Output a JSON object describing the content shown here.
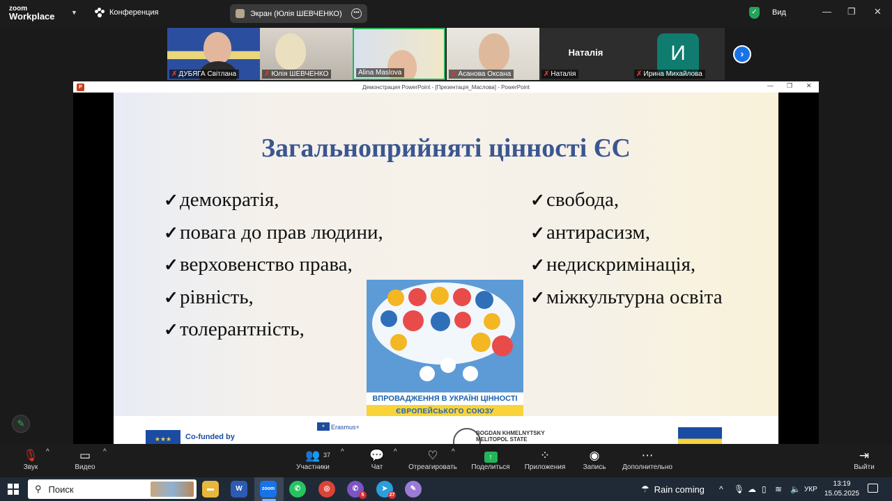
{
  "zoom": {
    "logo_line1": "zoom",
    "logo_line2": "Workplace",
    "conference_label": "Конференция",
    "screen_share_label": "Экран (Юлія ШЕВЧЕНКО)",
    "view_label": "Вид"
  },
  "participants": [
    {
      "name": "ДУБЯГА Світлана",
      "muted": true
    },
    {
      "name": "Юлія ШЕВЧЕНКО",
      "muted": true
    },
    {
      "name": "Alina Maslova",
      "muted": false,
      "active_speaker": true
    },
    {
      "name": "Асанова Оксана",
      "muted": true
    },
    {
      "name": "Наталія",
      "muted": true,
      "display_name": "Наталія"
    },
    {
      "name": "Ирина Михайлова",
      "muted": true,
      "initial": "И"
    }
  ],
  "powerpoint": {
    "window_title": "Демонстрация PowerPoint - [Презентація_Маслова] - PowerPoint"
  },
  "slide": {
    "title": "Загальноприйняті цінності ЄС",
    "left_items": [
      "демократія,",
      "повага до прав людини,",
      "верховенство права,",
      "рівність,",
      "толерантність,"
    ],
    "right_items": [
      "свобода,",
      "антирасизм,",
      "недискримінація,",
      "міжкультурна освіта"
    ],
    "poster_line1": "ВПРОВАДЖЕННЯ В УКРАЇНІ ЦІННОСТІ",
    "poster_line2": "ЄВРОПЕЙСЬКОГО СОЮЗУ",
    "footer_cofunded": "Co-funded by",
    "footer_erasmus": "Erasmus+",
    "footer_univ_line1": "BOGDAN KHMELNYTSKY",
    "footer_univ_line2": "MELITOPOL STATE"
  },
  "toolbar": {
    "sound": "Звук",
    "video": "Видео",
    "participants": "Участники",
    "participants_count": "37",
    "chat": "Чат",
    "react": "Отреагировать",
    "share": "Поделиться",
    "apps": "Приложения",
    "record": "Запись",
    "more": "Дополнительно",
    "leave": "Выйти"
  },
  "taskbar": {
    "search_placeholder": "Поиск",
    "weather": "Rain coming",
    "lang": "УКР",
    "time": "13:19",
    "date": "15.05.2025",
    "badge_viber": "5",
    "badge_telegram": "27"
  }
}
